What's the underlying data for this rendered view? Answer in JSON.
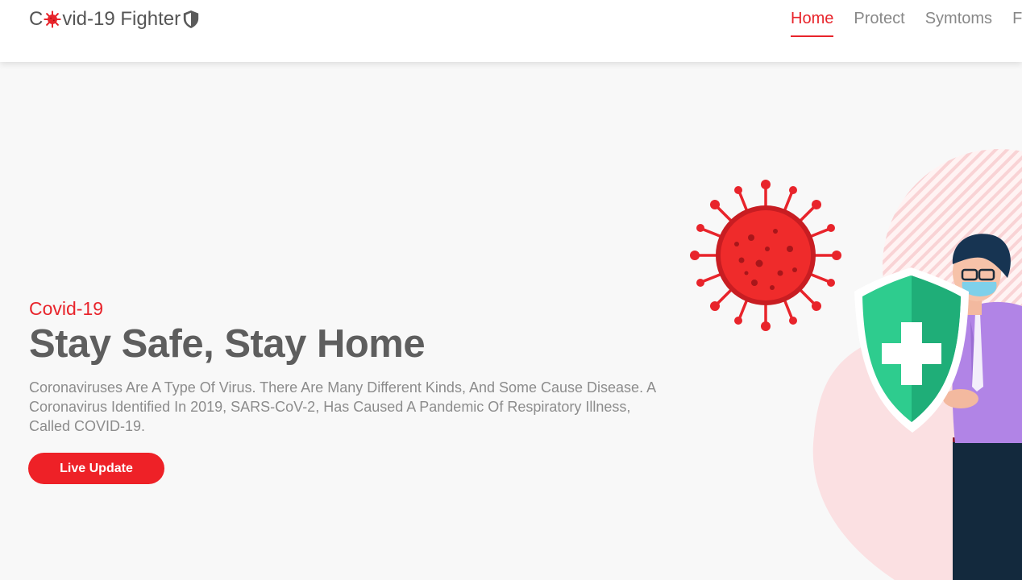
{
  "header": {
    "logo": {
      "prefix": "C",
      "suffix": "vid-19 Fighter"
    },
    "nav": [
      {
        "label": "Home",
        "active": true
      },
      {
        "label": "Protect",
        "active": false
      },
      {
        "label": "Symtoms",
        "active": false
      },
      {
        "label": "F",
        "active": false
      }
    ]
  },
  "hero": {
    "eyebrow": "Covid-19",
    "headline": "Stay Safe, Stay Home",
    "description": "Coronaviruses Are A Type Of Virus. There Are Many Different Kinds, And Some Cause Disease. A Coronavirus Identified In 2019, SARS-CoV-2, Has Caused A Pandemic Of Respiratory Illness, Called COVID-19.",
    "cta_label": "Live Update"
  },
  "colors": {
    "accent": "#e8242b",
    "button": "#ee2127",
    "heading": "#5e5e5e",
    "muted": "#8c8c8c",
    "shield_green": "#2ecc8e"
  },
  "icons": [
    "virus-icon",
    "shield-icon",
    "coronavirus-illustration",
    "doctor-with-shield-illustration"
  ]
}
